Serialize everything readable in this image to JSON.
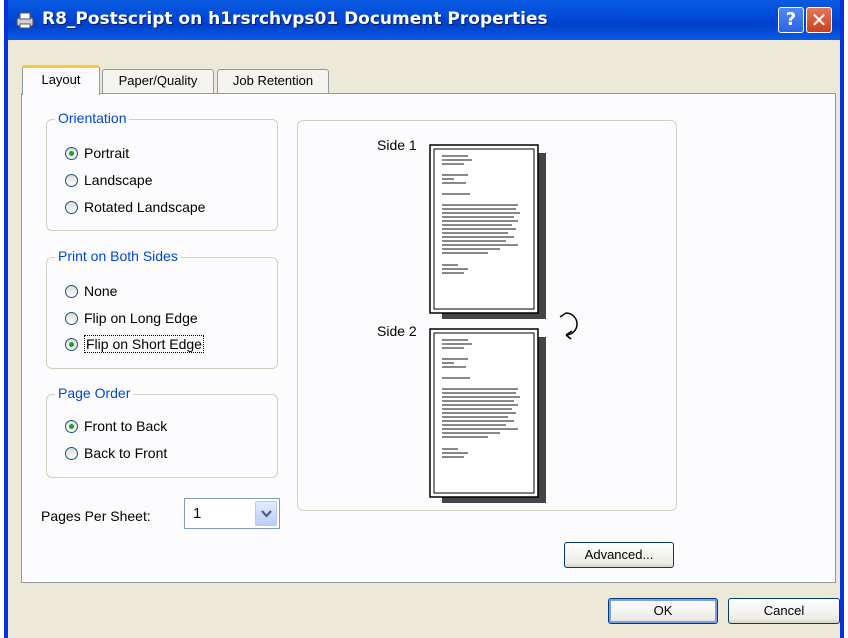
{
  "window": {
    "title": "R8_Postscript on h1rsrchvps01 Document Properties",
    "help_glyph": "?",
    "close_glyph": "✕"
  },
  "tabs": [
    {
      "label": "Layout",
      "active": true
    },
    {
      "label": "Paper/Quality",
      "active": false
    },
    {
      "label": "Job Retention",
      "active": false
    }
  ],
  "orientation": {
    "title": "Orientation",
    "options": [
      {
        "label": "Portrait",
        "checked": true
      },
      {
        "label": "Landscape",
        "checked": false
      },
      {
        "label": "Rotated Landscape",
        "checked": false
      }
    ]
  },
  "both_sides": {
    "title": "Print on Both Sides",
    "options": [
      {
        "label": "None",
        "checked": false
      },
      {
        "label": "Flip on Long Edge",
        "checked": false
      },
      {
        "label": "Flip on Short Edge",
        "checked": true
      }
    ]
  },
  "page_order": {
    "title": "Page Order",
    "options": [
      {
        "label": "Front to Back",
        "checked": true
      },
      {
        "label": "Back to Front",
        "checked": false
      }
    ]
  },
  "pages_per_sheet": {
    "label": "Pages Per Sheet:",
    "value": "1"
  },
  "preview": {
    "side1_label": "Side 1",
    "side2_label": "Side 2"
  },
  "buttons": {
    "advanced": "Advanced...",
    "ok": "OK",
    "cancel": "Cancel"
  },
  "colors": {
    "title_bar": "#0a5be0",
    "group_title": "#0046d5",
    "radio_check": "#21a121",
    "dialog_bg": "#ece9d8",
    "panel_bg": "#fcfcfe"
  }
}
